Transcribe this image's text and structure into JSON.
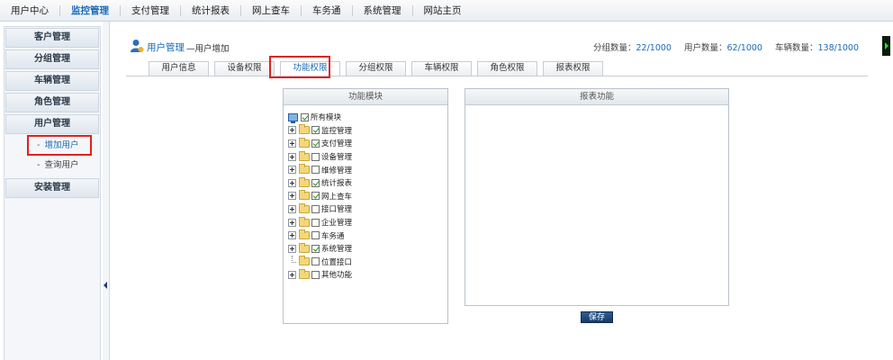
{
  "topnav": {
    "items": [
      {
        "label": "用户中心"
      },
      {
        "label": "监控管理"
      },
      {
        "label": "支付管理"
      },
      {
        "label": "统计报表"
      },
      {
        "label": "网上查车"
      },
      {
        "label": "车务通"
      },
      {
        "label": "系统管理"
      },
      {
        "label": "网站主页"
      }
    ],
    "active_index": 1
  },
  "sidebar": {
    "groups": [
      {
        "label": "客户管理"
      },
      {
        "label": "分组管理"
      },
      {
        "label": "车辆管理"
      },
      {
        "label": "角色管理"
      },
      {
        "label": "用户管理"
      }
    ],
    "subitems": [
      {
        "label": "增加用户"
      },
      {
        "label": "查询用户"
      }
    ],
    "after_group": {
      "label": "安装管理"
    }
  },
  "header": {
    "breadcrumb_main": "用户管理",
    "breadcrumb_sub": "—用户增加",
    "stats": [
      {
        "label": "分组数量：",
        "value": "22/1000"
      },
      {
        "label": "用户数量：",
        "value": "62/1000"
      },
      {
        "label": "车辆数量：",
        "value": "138/1000"
      }
    ]
  },
  "tabs": [
    {
      "label": "用户信息"
    },
    {
      "label": "设备权限"
    },
    {
      "label": "功能权限"
    },
    {
      "label": "分组权限"
    },
    {
      "label": "车辆权限"
    },
    {
      "label": "角色权限"
    },
    {
      "label": "报表权限"
    }
  ],
  "function_panel": {
    "title": "功能模块",
    "root": {
      "label": "所有模块",
      "checked": true
    },
    "items": [
      {
        "label": "监控管理",
        "checked": true
      },
      {
        "label": "支付管理",
        "checked": true
      },
      {
        "label": "设备管理",
        "checked": false
      },
      {
        "label": "维修管理",
        "checked": false
      },
      {
        "label": "统计报表",
        "checked": true
      },
      {
        "label": "网上查车",
        "checked": true
      },
      {
        "label": "接口管理",
        "checked": false
      },
      {
        "label": "企业管理",
        "checked": false
      },
      {
        "label": "车务通",
        "checked": false
      },
      {
        "label": "系统管理",
        "checked": true
      },
      {
        "label": "位置接口",
        "checked": false
      },
      {
        "label": "其他功能",
        "checked": false
      }
    ]
  },
  "report_panel": {
    "title": "报表功能"
  },
  "save_label": "保存",
  "colors": {
    "accent": "#1a6bb8",
    "highlight": "#e02020",
    "button": "#1f4a7c"
  }
}
